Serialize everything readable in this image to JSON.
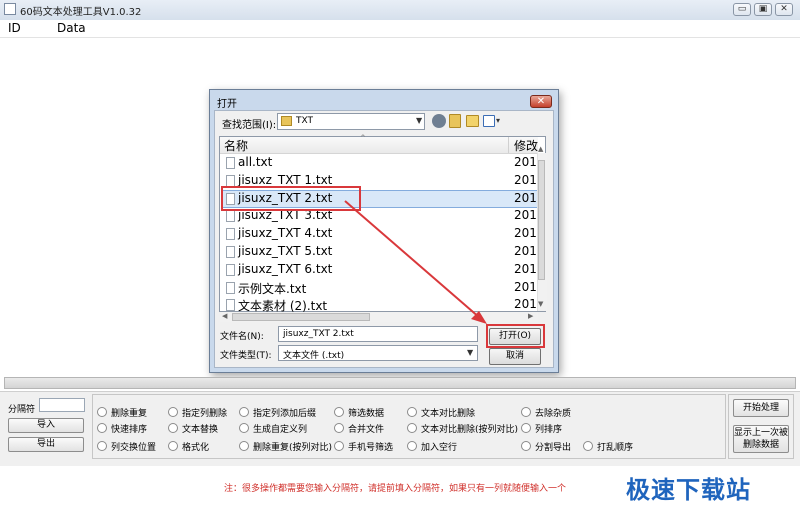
{
  "app": {
    "title": "60码文本处理工具V1.0.32",
    "minimize": "▭",
    "restore": "▣",
    "close": "✕"
  },
  "grid": {
    "col_id": "ID",
    "col_data": "Data"
  },
  "dialog": {
    "title": "打开",
    "close": "✕",
    "look_in_label": "查找范围(I):",
    "look_in_value": "TXT",
    "list_header_name": "名称",
    "list_header_modified": "修改",
    "files": [
      {
        "name": "all.txt",
        "modified": "201"
      },
      {
        "name": "jisuxz_TXT 1.txt",
        "modified": "201"
      },
      {
        "name": "jisuxz_TXT 2.txt",
        "modified": "201"
      },
      {
        "name": "jisuxz_TXT 3.txt",
        "modified": "201"
      },
      {
        "name": "jisuxz_TXT 4.txt",
        "modified": "201"
      },
      {
        "name": "jisuxz_TXT 5.txt",
        "modified": "201"
      },
      {
        "name": "jisuxz_TXT 6.txt",
        "modified": "201"
      },
      {
        "name": "示例文本.txt",
        "modified": "201"
      },
      {
        "name": "文本素材 (2).txt",
        "modified": "201"
      }
    ],
    "selected_index": 2,
    "filename_label": "文件名(N):",
    "filename_value": "jisuxz_TXT 2.txt",
    "filetype_label": "文件类型(T):",
    "filetype_value": "文本文件 (.txt)",
    "open_button": "打开(O)",
    "cancel_button": "取消"
  },
  "panel": {
    "separator_label": "分隔符",
    "import_button": "导入",
    "export_button": "导出",
    "options": [
      [
        "删除重复",
        "指定列删除",
        "指定列添加后缀",
        "筛选数据",
        "文本对比删除",
        "去除杂质"
      ],
      [
        "快速排序",
        "文本替换",
        "生成自定义列",
        "合并文件",
        "文本对比删除(按列对比)",
        "列排序"
      ],
      [
        "列交换位置",
        "格式化",
        "删除重复(按列对比)",
        "手机号筛选",
        "加入空行",
        "分割导出",
        "打乱顺序"
      ]
    ],
    "start_button": "开始处理",
    "show_deleted_button_line1": "显示上一次被",
    "show_deleted_button_line2": "删除数据",
    "note": "注：很多操作都需要您输入分隔符，请提前填入分隔符，如果只有一列就随便输入一个"
  },
  "watermark": {
    "text": "极速下载站"
  },
  "colors": {
    "highlight_red": "#d9383b",
    "watermark_blue": "#1f64bd"
  }
}
